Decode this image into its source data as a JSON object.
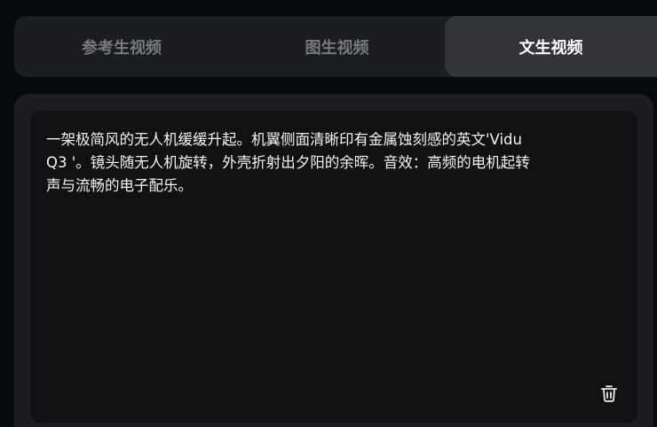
{
  "tabs": [
    {
      "label": "参考生视频",
      "active": false
    },
    {
      "label": "图生视频",
      "active": false
    },
    {
      "label": "文生视频",
      "active": true
    }
  ],
  "prompt": {
    "text": "一架极简风的无人机缓缓升起。机翼侧面清晰印有金属蚀刻感的英文'Vidu\nQ3 '。镜头随无人机旋转，外壳折射出夕阳的余晖。音效：高频的电机起转\n声与流畅的电子配乐。"
  },
  "icons": {
    "clear": "trash-icon"
  },
  "colors": {
    "background": "#05080d",
    "panel": "#1b1d20",
    "active_tab": "#323438",
    "editor": "#101113",
    "text": "#f2f3f5",
    "inactive_text": "#76797e"
  }
}
